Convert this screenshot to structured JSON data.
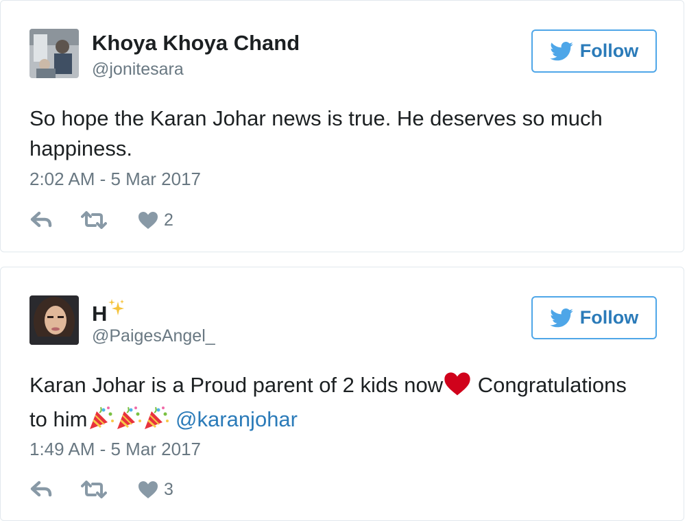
{
  "tweets": [
    {
      "display_name": "Khoya Khoya Chand",
      "handle": "@jonitesara",
      "follow_label": "Follow",
      "text": "So hope the Karan Johar news is true. He deserves so much happiness.",
      "timestamp": "2:02 AM - 5 Mar 2017",
      "likes": "2"
    },
    {
      "display_name": "H",
      "name_emoji": "sparkles-icon",
      "handle": "@PaigesAngel_",
      "follow_label": "Follow",
      "text_part1": "Karan Johar is a Proud parent of 2 kids now",
      "text_part2": " Congratulations to him",
      "mention": "@karanjohar",
      "timestamp": "1:49 AM - 5 Mar 2017",
      "likes": "3"
    }
  ],
  "icons": {
    "follow": "twitter-bird-icon",
    "reply": "reply-icon",
    "retweet": "retweet-icon",
    "like": "heart-icon",
    "heart_emoji": "red-heart-icon",
    "party_emoji": "party-popper-icon"
  },
  "colors": {
    "accent": "#2b7bb9",
    "button_border": "#4ea6e8",
    "muted_text": "#697882",
    "border": "#e1e8ed",
    "heart_emoji": "#d0021b"
  }
}
